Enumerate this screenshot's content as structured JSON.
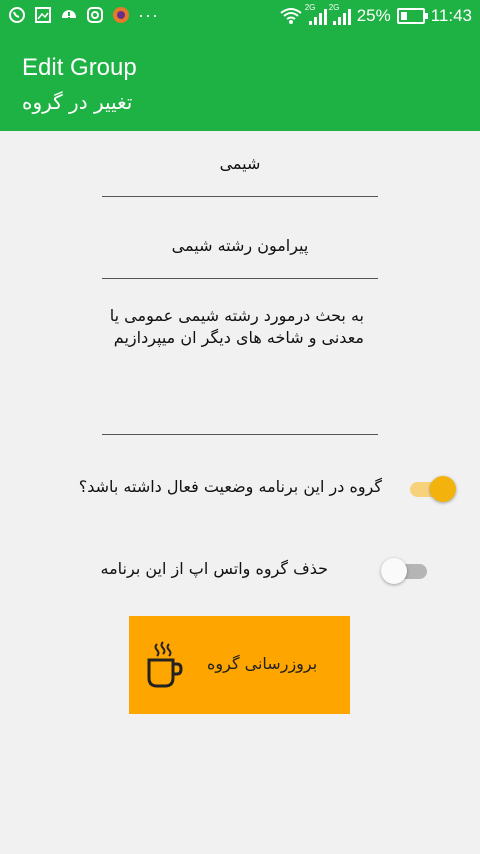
{
  "status_bar": {
    "left_icons": [
      "whatsapp-icon",
      "image-icon",
      "warning-icon",
      "instagram-icon",
      "firefox-icon"
    ],
    "more": "···",
    "signal_tag_1": "2G",
    "signal_tag_2": "2G",
    "battery_percent": "25%",
    "time": "11:43"
  },
  "app_bar": {
    "title": "Edit Group",
    "subtitle": "تغییر در گروه",
    "color": "#1eb244"
  },
  "form": {
    "group_name": "شیمی",
    "group_topic": "پیرامون رشته شیمی",
    "group_description": [
      "به بحث درمورد رشته شیمی عمومی یا",
      "معدنی و شاخه های دیگر ان میپردازیم"
    ]
  },
  "switches": {
    "active": {
      "label": "گروه در این برنامه وضعیت فعال داشته باشد؟",
      "checked": true,
      "color": "#f4b20d"
    },
    "delete_whatsapp": {
      "label": "حذف گروه واتس اپ از این برنامه",
      "checked": false
    }
  },
  "update_button": {
    "label": "بروزرسانی گروه",
    "icon": "coffee-mug-icon",
    "color": "#ffa500"
  }
}
